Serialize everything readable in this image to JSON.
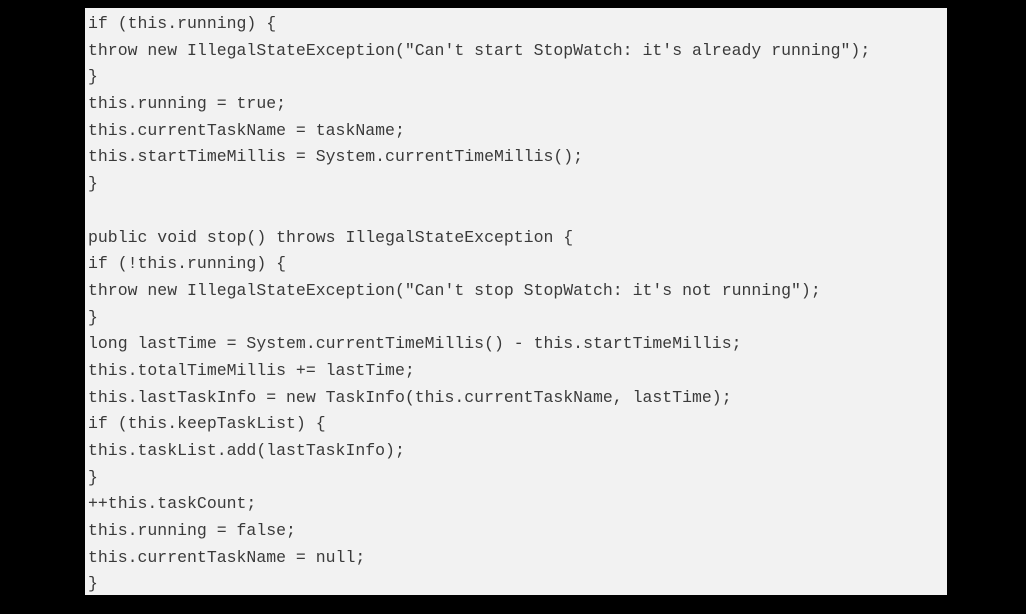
{
  "code": {
    "lines": [
      "if (this.running) {",
      "throw new IllegalStateException(\"Can't start StopWatch: it's already running\");",
      "}",
      "this.running = true;",
      "this.currentTaskName = taskName;",
      "this.startTimeMillis = System.currentTimeMillis();",
      "}",
      "",
      "public void stop() throws IllegalStateException {",
      "if (!this.running) {",
      "throw new IllegalStateException(\"Can't stop StopWatch: it's not running\");",
      "}",
      "long lastTime = System.currentTimeMillis() - this.startTimeMillis;",
      "this.totalTimeMillis += lastTime;",
      "this.lastTaskInfo = new TaskInfo(this.currentTaskName, lastTime);",
      "if (this.keepTaskList) {",
      "this.taskList.add(lastTaskInfo);",
      "}",
      "++this.taskCount;",
      "this.running = false;",
      "this.currentTaskName = null;",
      "}"
    ]
  },
  "colors": {
    "background": "#000000",
    "panel": "#f2f2f2",
    "text": "#3a3a3a"
  }
}
